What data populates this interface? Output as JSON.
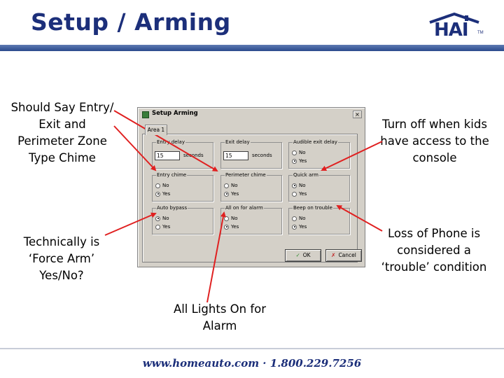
{
  "slide": {
    "title": "Setup / Arming",
    "logo_text": "HAI",
    "logo_tm": "TM",
    "footer": "www.homeauto.com · 1.800.229.7256"
  },
  "annotations": {
    "entry_exit_chime": "Should Say Entry/ Exit and Perimeter Zone Type Chime",
    "quick_arm": "Turn off when kids have access to the console",
    "auto_bypass": "Technically is ‘Force Arm’ Yes/No?",
    "beep_on_trouble": "Loss of Phone is considered a ‘trouble’ condition",
    "all_on_alarm": "All Lights On for Alarm"
  },
  "dialog": {
    "title": "Setup Arming",
    "close_label": "×",
    "tab_label": "Area 1",
    "groups": {
      "entry_delay": {
        "label": "Entry delay",
        "value": "15",
        "units": "seconds"
      },
      "exit_delay": {
        "label": "Exit delay",
        "value": "15",
        "units": "seconds"
      },
      "audible_exit_delay": {
        "label": "Audible exit delay",
        "no": "No",
        "yes": "Yes",
        "selected": "yes"
      },
      "entry_chime": {
        "label": "Entry chime",
        "no": "No",
        "yes": "Yes",
        "selected": "yes"
      },
      "perimeter_chime": {
        "label": "Perimeter chime",
        "no": "No",
        "yes": "Yes",
        "selected": "yes"
      },
      "quick_arm": {
        "label": "Quick arm",
        "no": "No",
        "yes": "Yes",
        "selected": "no"
      },
      "auto_bypass": {
        "label": "Auto bypass",
        "no": "No",
        "yes": "Yes",
        "selected": "no"
      },
      "all_on_for_alarm": {
        "label": "All on for alarm",
        "no": "No",
        "yes": "Yes",
        "selected": "yes"
      },
      "beep_on_trouble": {
        "label": "Beep on trouble",
        "no": "No",
        "yes": "Yes",
        "selected": "yes"
      }
    },
    "ok_label": "OK",
    "cancel_label": "Cancel",
    "ok_mark": "✓",
    "cancel_mark": "✗"
  },
  "colors": {
    "title": "#1c2f7a",
    "arrow": "#e02020",
    "dialog_face": "#d4d0c8"
  }
}
